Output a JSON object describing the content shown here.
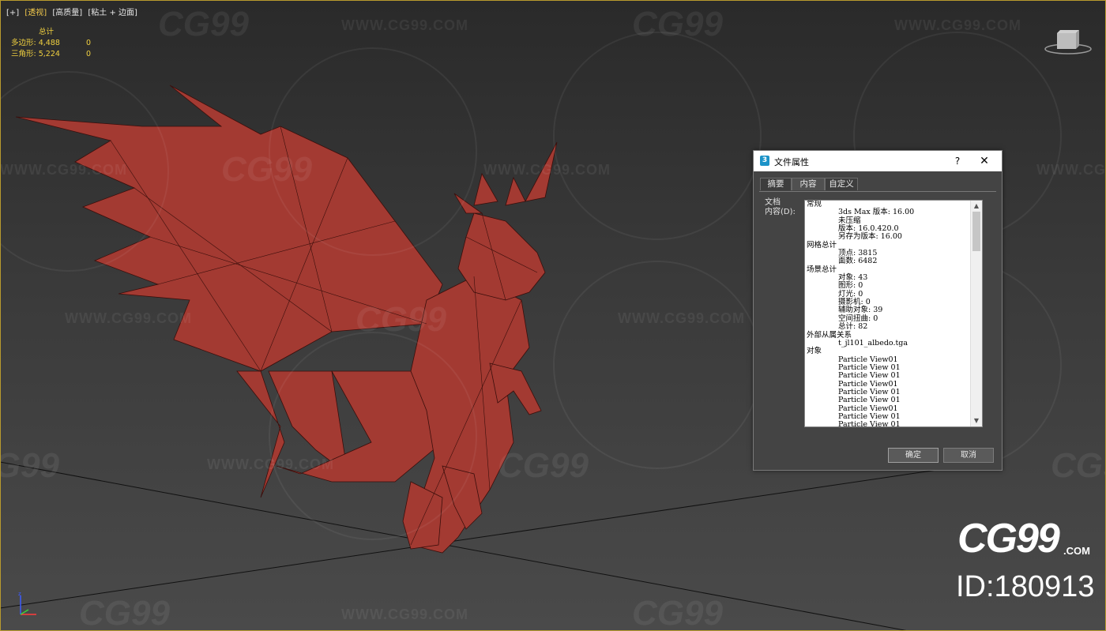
{
  "viewport": {
    "labels": [
      "[+]",
      "[透视]",
      "[高质量]",
      "[粘土 + 边面]"
    ],
    "active_label_index": 1,
    "stats": {
      "header": "总计",
      "rows": [
        {
          "label": "多边形: 4,488",
          "value": "0"
        },
        {
          "label": "三角形: 5,224",
          "value": "0"
        }
      ]
    },
    "border_color": "#b89a2e",
    "model_color": "#a33a32"
  },
  "watermarks": {
    "url": "WWW.CG99.COM",
    "logo": "CG99",
    "logo_suffix": ".com"
  },
  "brand": {
    "logo": "CG99",
    "suffix": ".COM",
    "id": "ID:180913"
  },
  "dialog": {
    "title": "文件属性",
    "help": "?",
    "close": "✕",
    "tabs": [
      "摘要",
      "内容",
      "自定义"
    ],
    "selected_tab": "内容",
    "label": "文档\n内容(D):",
    "content": [
      {
        "type": "sec",
        "text": "常规"
      },
      {
        "type": "item",
        "text": "3ds Max 版本: 16.00"
      },
      {
        "type": "item",
        "text": "未压缩"
      },
      {
        "type": "item",
        "text": "版本: 16.0.420.0"
      },
      {
        "type": "item",
        "text": "另存为版本: 16.00"
      },
      {
        "type": "sec",
        "text": "网格总计"
      },
      {
        "type": "item",
        "text": "顶点: 3815"
      },
      {
        "type": "item",
        "text": "面数: 6482"
      },
      {
        "type": "sec",
        "text": "场景总计"
      },
      {
        "type": "item",
        "text": "对象: 43"
      },
      {
        "type": "item",
        "text": "图形: 0"
      },
      {
        "type": "item",
        "text": "灯光: 0"
      },
      {
        "type": "item",
        "text": "摄影机: 0"
      },
      {
        "type": "item",
        "text": "辅助对象: 39"
      },
      {
        "type": "item",
        "text": "空间扭曲: 0"
      },
      {
        "type": "item",
        "text": "总计: 82"
      },
      {
        "type": "sec",
        "text": "外部从属关系"
      },
      {
        "type": "item",
        "text": "t_jl101_albedo.tga"
      },
      {
        "type": "sec",
        "text": "对象"
      },
      {
        "type": "item",
        "text": "Particle View01"
      },
      {
        "type": "item",
        "text": "Particle View 01"
      },
      {
        "type": "item",
        "text": "Particle View 01"
      },
      {
        "type": "item",
        "text": "Particle View01"
      },
      {
        "type": "item",
        "text": "Particle View 01"
      },
      {
        "type": "item",
        "text": "Particle View 01"
      },
      {
        "type": "item",
        "text": "Particle View01"
      },
      {
        "type": "item",
        "text": "Particle View 01"
      },
      {
        "type": "item",
        "text": "Particle View 01"
      }
    ],
    "ok": "确定",
    "cancel": "取消"
  }
}
